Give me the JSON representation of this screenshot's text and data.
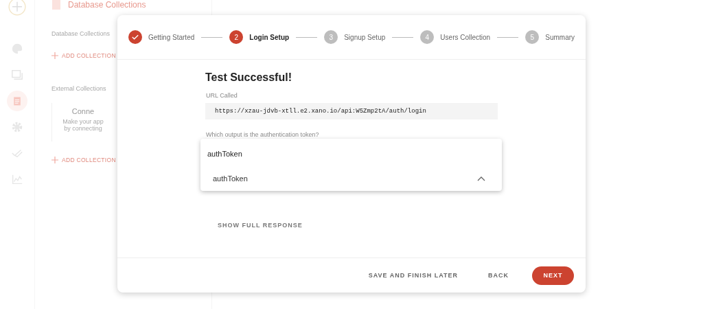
{
  "background": {
    "header_title": "Database Collections",
    "section_1": "Database Collections",
    "add_1": "ADD COLLECTION",
    "section_2": "External Collections",
    "card_title": "Conne",
    "card_text_1": "Make your app",
    "card_text_2": "by connecting",
    "add_2": "ADD COLLECTION"
  },
  "steps": [
    {
      "label": "Getting Started",
      "completed": true,
      "selected": false
    },
    {
      "number": "2",
      "label": "Login Setup",
      "completed": false,
      "selected": true
    },
    {
      "number": "3",
      "label": "Signup Setup",
      "completed": false,
      "selected": false
    },
    {
      "number": "4",
      "label": "Users Collection",
      "completed": false,
      "selected": false
    },
    {
      "number": "5",
      "label": "Summary",
      "completed": false,
      "selected": false
    }
  ],
  "content": {
    "title": "Test Successful!",
    "url_label": "URL Called",
    "url": "https://xzau-jdvb-xtll.e2.xano.io/api:W5Zmp2tA/auth/login",
    "question": "Which output is the authentication token?",
    "dropdown": {
      "filter": "authToken",
      "option": "authToken",
      "expanded": true
    },
    "show_full_response": "SHOW FULL RESPONSE"
  },
  "footer": {
    "buttons": [
      {
        "label": "SAVE AND FINISH LATER",
        "kind": "text"
      },
      {
        "label": "BACK",
        "kind": "text"
      },
      {
        "label": "NEXT",
        "kind": "primary"
      }
    ]
  }
}
